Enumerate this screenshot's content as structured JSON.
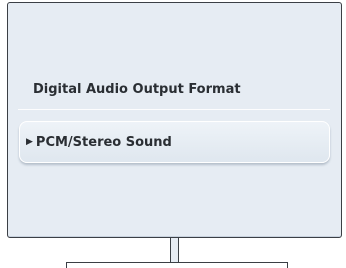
{
  "menu": {
    "title": "Digital Audio Output Format",
    "options": [
      {
        "label": "PCM/Stereo Sound",
        "selected": true,
        "indicator_icon": "triangle-right-icon"
      }
    ]
  },
  "colors": {
    "screen_background": "#e6ecf3",
    "text": "#2a2e33",
    "bezel": "#3b3f45"
  }
}
